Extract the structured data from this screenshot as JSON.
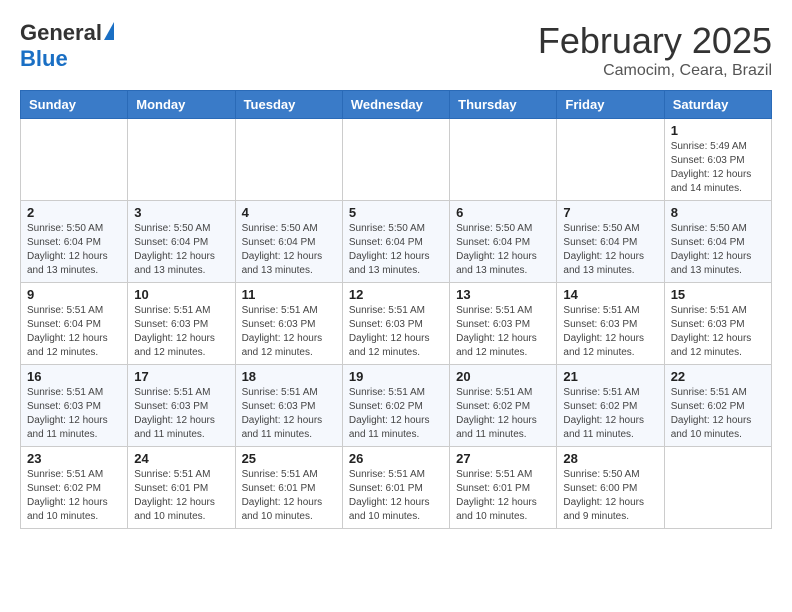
{
  "header": {
    "logo_general": "General",
    "logo_blue": "Blue",
    "month_title": "February 2025",
    "location": "Camocim, Ceara, Brazil"
  },
  "weekdays": [
    "Sunday",
    "Monday",
    "Tuesday",
    "Wednesday",
    "Thursday",
    "Friday",
    "Saturday"
  ],
  "weeks": [
    [
      {
        "day": "",
        "info": ""
      },
      {
        "day": "",
        "info": ""
      },
      {
        "day": "",
        "info": ""
      },
      {
        "day": "",
        "info": ""
      },
      {
        "day": "",
        "info": ""
      },
      {
        "day": "",
        "info": ""
      },
      {
        "day": "1",
        "info": "Sunrise: 5:49 AM\nSunset: 6:03 PM\nDaylight: 12 hours\nand 14 minutes."
      }
    ],
    [
      {
        "day": "2",
        "info": "Sunrise: 5:50 AM\nSunset: 6:04 PM\nDaylight: 12 hours\nand 13 minutes."
      },
      {
        "day": "3",
        "info": "Sunrise: 5:50 AM\nSunset: 6:04 PM\nDaylight: 12 hours\nand 13 minutes."
      },
      {
        "day": "4",
        "info": "Sunrise: 5:50 AM\nSunset: 6:04 PM\nDaylight: 12 hours\nand 13 minutes."
      },
      {
        "day": "5",
        "info": "Sunrise: 5:50 AM\nSunset: 6:04 PM\nDaylight: 12 hours\nand 13 minutes."
      },
      {
        "day": "6",
        "info": "Sunrise: 5:50 AM\nSunset: 6:04 PM\nDaylight: 12 hours\nand 13 minutes."
      },
      {
        "day": "7",
        "info": "Sunrise: 5:50 AM\nSunset: 6:04 PM\nDaylight: 12 hours\nand 13 minutes."
      },
      {
        "day": "8",
        "info": "Sunrise: 5:50 AM\nSunset: 6:04 PM\nDaylight: 12 hours\nand 13 minutes."
      }
    ],
    [
      {
        "day": "9",
        "info": "Sunrise: 5:51 AM\nSunset: 6:04 PM\nDaylight: 12 hours\nand 12 minutes."
      },
      {
        "day": "10",
        "info": "Sunrise: 5:51 AM\nSunset: 6:03 PM\nDaylight: 12 hours\nand 12 minutes."
      },
      {
        "day": "11",
        "info": "Sunrise: 5:51 AM\nSunset: 6:03 PM\nDaylight: 12 hours\nand 12 minutes."
      },
      {
        "day": "12",
        "info": "Sunrise: 5:51 AM\nSunset: 6:03 PM\nDaylight: 12 hours\nand 12 minutes."
      },
      {
        "day": "13",
        "info": "Sunrise: 5:51 AM\nSunset: 6:03 PM\nDaylight: 12 hours\nand 12 minutes."
      },
      {
        "day": "14",
        "info": "Sunrise: 5:51 AM\nSunset: 6:03 PM\nDaylight: 12 hours\nand 12 minutes."
      },
      {
        "day": "15",
        "info": "Sunrise: 5:51 AM\nSunset: 6:03 PM\nDaylight: 12 hours\nand 12 minutes."
      }
    ],
    [
      {
        "day": "16",
        "info": "Sunrise: 5:51 AM\nSunset: 6:03 PM\nDaylight: 12 hours\nand 11 minutes."
      },
      {
        "day": "17",
        "info": "Sunrise: 5:51 AM\nSunset: 6:03 PM\nDaylight: 12 hours\nand 11 minutes."
      },
      {
        "day": "18",
        "info": "Sunrise: 5:51 AM\nSunset: 6:03 PM\nDaylight: 12 hours\nand 11 minutes."
      },
      {
        "day": "19",
        "info": "Sunrise: 5:51 AM\nSunset: 6:02 PM\nDaylight: 12 hours\nand 11 minutes."
      },
      {
        "day": "20",
        "info": "Sunrise: 5:51 AM\nSunset: 6:02 PM\nDaylight: 12 hours\nand 11 minutes."
      },
      {
        "day": "21",
        "info": "Sunrise: 5:51 AM\nSunset: 6:02 PM\nDaylight: 12 hours\nand 11 minutes."
      },
      {
        "day": "22",
        "info": "Sunrise: 5:51 AM\nSunset: 6:02 PM\nDaylight: 12 hours\nand 10 minutes."
      }
    ],
    [
      {
        "day": "23",
        "info": "Sunrise: 5:51 AM\nSunset: 6:02 PM\nDaylight: 12 hours\nand 10 minutes."
      },
      {
        "day": "24",
        "info": "Sunrise: 5:51 AM\nSunset: 6:01 PM\nDaylight: 12 hours\nand 10 minutes."
      },
      {
        "day": "25",
        "info": "Sunrise: 5:51 AM\nSunset: 6:01 PM\nDaylight: 12 hours\nand 10 minutes."
      },
      {
        "day": "26",
        "info": "Sunrise: 5:51 AM\nSunset: 6:01 PM\nDaylight: 12 hours\nand 10 minutes."
      },
      {
        "day": "27",
        "info": "Sunrise: 5:51 AM\nSunset: 6:01 PM\nDaylight: 12 hours\nand 10 minutes."
      },
      {
        "day": "28",
        "info": "Sunrise: 5:50 AM\nSunset: 6:00 PM\nDaylight: 12 hours\nand 9 minutes."
      },
      {
        "day": "",
        "info": ""
      }
    ]
  ]
}
